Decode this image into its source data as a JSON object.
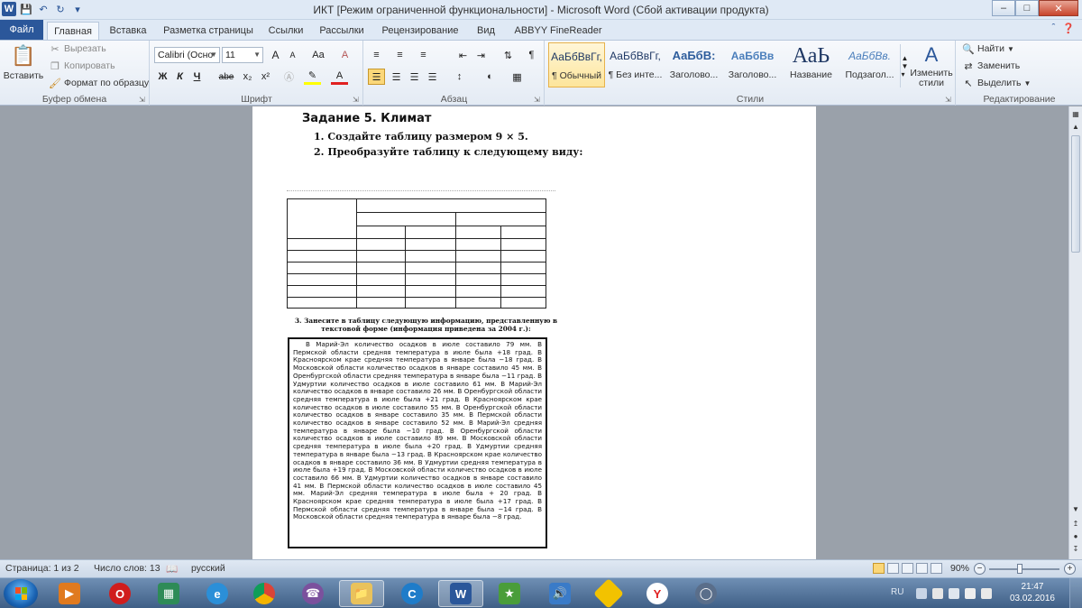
{
  "window": {
    "title": "ИКТ [Режим ограниченной функциональности]  -  Microsoft Word (Сбой активации продукта)"
  },
  "tabs": [
    {
      "label": "Файл",
      "active": false
    },
    {
      "label": "Главная",
      "active": true
    },
    {
      "label": "Вставка",
      "active": false
    },
    {
      "label": "Разметка страницы",
      "active": false
    },
    {
      "label": "Ссылки",
      "active": false
    },
    {
      "label": "Рассылки",
      "active": false
    },
    {
      "label": "Рецензирование",
      "active": false
    },
    {
      "label": "Вид",
      "active": false
    },
    {
      "label": "ABBYY FineReader 11",
      "active": false
    }
  ],
  "clipboard": {
    "label": "Буфер обмена",
    "paste": "Вставить",
    "cut": "Вырезать",
    "copy": "Копировать",
    "format_painter": "Формат по образцу"
  },
  "font": {
    "label": "Шрифт",
    "family": "Calibri (Осно",
    "size": "11",
    "bold": "Ж",
    "italic": "К",
    "underline": "Ч",
    "strike": "abe",
    "subscript": "x₂",
    "superscript": "x²",
    "grow": "A",
    "shrink": "A",
    "case": "Aa",
    "clear": "A"
  },
  "paragraph": {
    "label": "Абзац"
  },
  "styles": {
    "label": "Стили",
    "items": [
      {
        "sample": "АаБбВвГг,",
        "name": "¶ Обычный",
        "selected": true
      },
      {
        "sample": "АаБбВвГг,",
        "name": "¶ Без инте...",
        "selected": false
      },
      {
        "sample": "АаБбВ:",
        "name": "Заголово...",
        "selected": false
      },
      {
        "sample": "АаБбВв",
        "name": "Заголово...",
        "selected": false
      },
      {
        "sample": "АаЬ",
        "name": "Название",
        "selected": false
      },
      {
        "sample": "АаБбВв.",
        "name": "Подзагол...",
        "selected": false
      }
    ],
    "change_styles": "Изменить стили"
  },
  "editing": {
    "label": "Редактирование",
    "find": "Найти",
    "replace": "Заменить",
    "select": "Выделить"
  },
  "document": {
    "heading": "Задание 5.  Климат",
    "step1": "1.  Создайте таблицу размером 9 × 5.",
    "step2": "2.  Преобразуйте таблицу к следующему виду:",
    "step3": "3.  Занесите в таблицу следующую информацию, представленную в текстовой форме (информация приведена за 2004 г.):",
    "body": "В Марий-Эл количество осадков в июле составило 79 мм. В Пермской области средняя температура в июле была +18 град. В Красноярском крае средняя температура в январе была −18 град. В Московской области количество осадков в январе составило 45 мм. В Оренбургской области средняя температура в январе была −11 град. В Удмуртии количество осадков в июле составило 61 мм. В Марий-Эл количество осадков в январе составило 26 мм. В Оренбургской области средняя температура в июле была +21 град. В Красноярском крае количество осадков в июле составило 55 мм. В Оренбургской области количество осадков в январе составило 35 мм. В Пермской области количество осадков в январе составило 52 мм. В Марий-Эл средняя температура в январе была −10 град. В Оренбургской области количество осадков в июле составило 89 мм. В Московской области средняя температура в июле была +20 град. В Удмуртии средняя температура в январе была −13 град. В Красноярском крае количество осадков в январе составило 36 мм. В Удмуртии средняя температура в июле была +19 град. В Московской области количество осадков в июле составило 66 мм. В Удмуртии количество осадков в январе составило 41 мм. В Пермской области количество осадков в июле составило 45 мм. Марий-Эл средняя температура в июле была + 20 град. В Красноярском крае средняя температура в июле была +17 град. В Пермской области средняя температура в январе была −14 град. В Московской области средняя температура в январе была −8 град."
  },
  "status": {
    "page": "Страница: 1 из 2",
    "words": "Число слов: 13",
    "language": "русский",
    "zoom": "90%"
  },
  "taskbar": {
    "lang": "RU",
    "time": "21:47",
    "date": "03.02.2016"
  },
  "colors": {
    "accent": "#2b579a",
    "ribbon_bg": "#e4ebf4",
    "selected_style": "#fde59b"
  }
}
